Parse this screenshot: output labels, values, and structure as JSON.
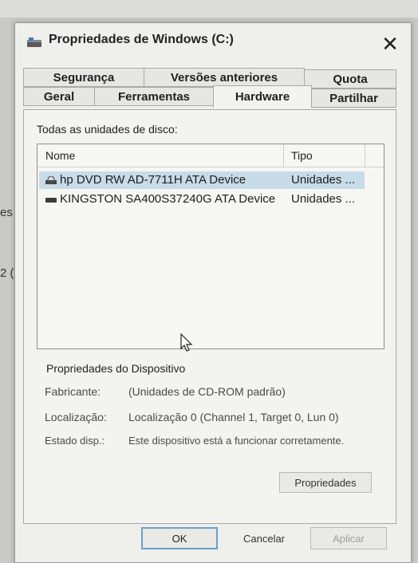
{
  "background": {
    "left_text_1": "es",
    "left_text_2": "2 ("
  },
  "dialog": {
    "title": "Propriedades de Windows (C:)",
    "close_glyph": "✕",
    "tabs_row1": [
      "Segurança",
      "Versões anteriores",
      "Quota"
    ],
    "tabs_row2": [
      "Geral",
      "Ferramentas",
      "Hardware",
      "Partilhar"
    ],
    "active_tab": "Hardware"
  },
  "hardware": {
    "all_disks_label": "Todas as unidades de disco:",
    "columns": {
      "name": "Nome",
      "type": "Tipo"
    },
    "devices": [
      {
        "name": "hp DVD RW AD-7711H ATA Device",
        "type": "Unidades ...",
        "icon": "optical-drive-icon",
        "selected": true
      },
      {
        "name": "KINGSTON SA400S37240G ATA Device",
        "type": "Unidades ...",
        "icon": "hard-drive-icon",
        "selected": false
      }
    ],
    "properties_heading": "Propriedades do Dispositivo",
    "manufacturer_label": "Fabricante:",
    "manufacturer_value": "(Unidades de CD-ROM padrão)",
    "location_label": "Localização:",
    "location_value": "Localização 0 (Channel 1, Target 0, Lun 0)",
    "status_label": "Estado disp.:",
    "status_value": "Este dispositivo está a funcionar corretamente.",
    "properties_button": "Propriedades"
  },
  "footer": {
    "ok": "OK",
    "cancel": "Cancelar",
    "apply": "Aplicar"
  }
}
